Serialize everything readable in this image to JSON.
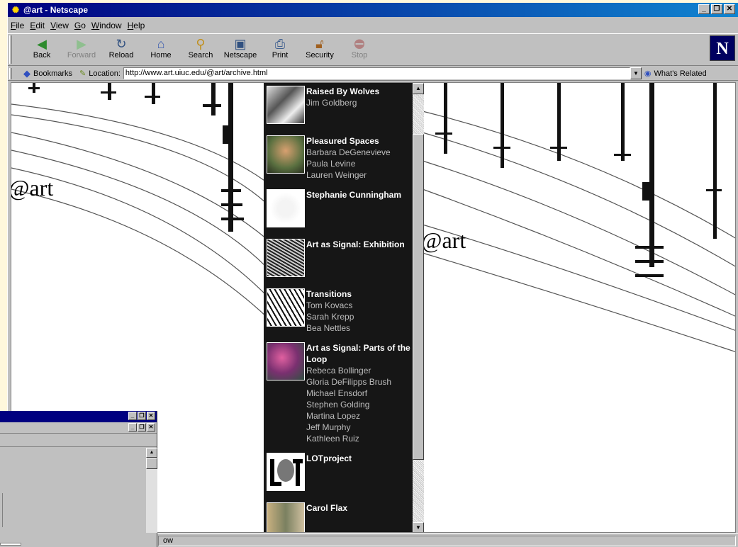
{
  "window": {
    "title": "@art - Netscape",
    "controls": [
      "_",
      "❐",
      "✕"
    ]
  },
  "menu": [
    "File",
    "Edit",
    "View",
    "Go",
    "Window",
    "Help"
  ],
  "toolbar": {
    "back": "Back",
    "forward": "Forward",
    "reload": "Reload",
    "home": "Home",
    "search": "Search",
    "netscape": "Netscape",
    "print": "Print",
    "security": "Security",
    "stop": "Stop",
    "logo": "N"
  },
  "location": {
    "bookmarks": "Bookmarks",
    "label": "Location:",
    "url": "http://www.art.uiuc.edu/@art/archive.html",
    "related": "What's Related"
  },
  "page": {
    "logo_left": "@art",
    "logo_right": "@art",
    "archive": [
      {
        "title": "Raised By Wolves",
        "names": [
          "Jim Goldberg"
        ]
      },
      {
        "title": "Pleasured Spaces",
        "names": [
          "Barbara DeGenevieve",
          "Paula Levine",
          "Lauren Weinger"
        ]
      },
      {
        "title": "Stephanie Cunningham",
        "names": []
      },
      {
        "title": "Art as Signal: Exhibition",
        "names": []
      },
      {
        "title": "Transitions",
        "names": [
          "Tom Kovacs",
          "Sarah Krepp",
          "Bea Nettles"
        ]
      },
      {
        "title": "Art as Signal: Parts of the Loop",
        "names": [
          "Rebeca Bollinger",
          "Gloria DeFilipps Brush",
          "Michael Ensdorf",
          "Stephen Golding",
          "Martina Lopez",
          "Jeff Murphy",
          "Kathleen Ruiz"
        ]
      },
      {
        "title": "LOTproject",
        "names": []
      },
      {
        "title": "Carol Flax",
        "names": []
      }
    ]
  },
  "status": {
    "text": "ow"
  }
}
